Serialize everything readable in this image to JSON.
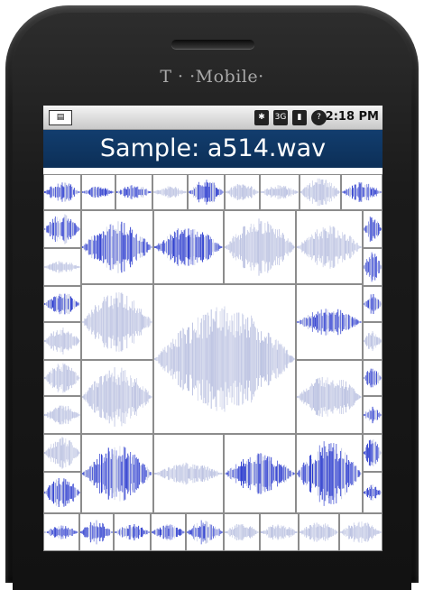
{
  "device": {
    "brand": "T · ·Mobile·"
  },
  "status_bar": {
    "time": "2:18 PM",
    "network_badge": "3G",
    "icons": [
      "notification-icon",
      "bluetooth-icon",
      "network-3g-icon",
      "signal-icon",
      "help-icon"
    ]
  },
  "app": {
    "title": "Sample: a514.wav"
  },
  "colors": {
    "title_bar": "#123d6e",
    "waveform_dark": "#2233cc",
    "waveform_light": "#b8bfe0"
  }
}
